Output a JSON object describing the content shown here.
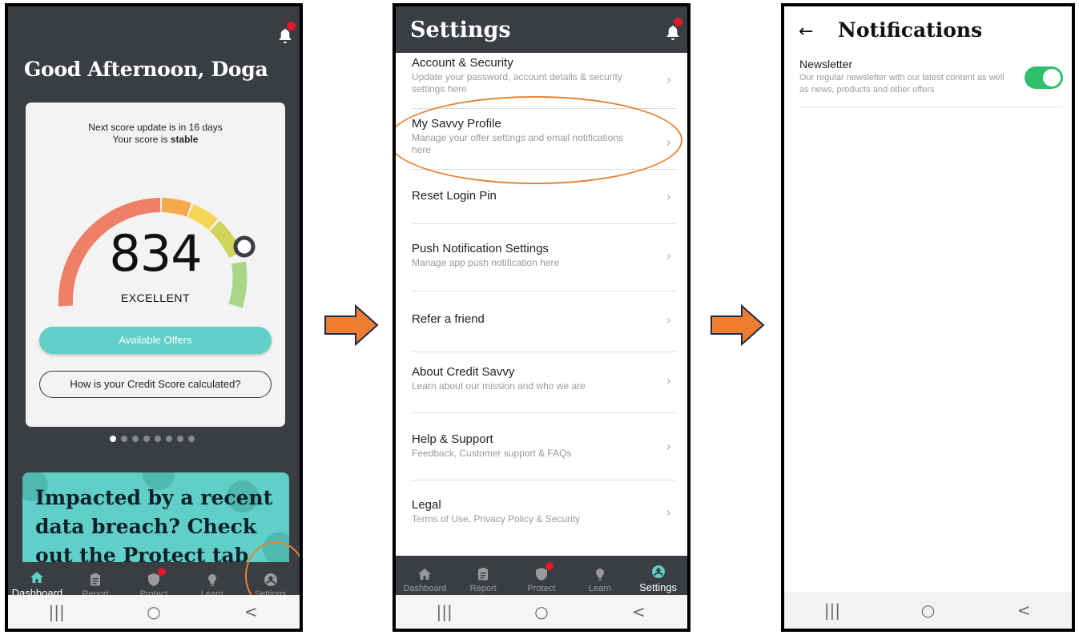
{
  "colors": {
    "accent": "#5fcfc7",
    "dark_bg": "#3a3d42",
    "highlight": "#e58336",
    "notification_dot": "#e0192e",
    "toggle_on": "#2fc06b",
    "flow_arrow": "#ee7d31"
  },
  "dashboard": {
    "greeting": "Good Afternoon, Doga",
    "next_update": "Next score update is in 16 days",
    "score_status_prefix": "Your score is ",
    "score_status": "stable",
    "score": "834",
    "rating": "EXCELLENT",
    "offers_button": "Available Offers",
    "calc_button": "How is your Credit Score calculated?",
    "carousel_pages": 8,
    "carousel_active": 1,
    "promo_text": "Impacted by a recent data breach? Check out the Protect tab"
  },
  "nav": {
    "items": [
      {
        "label": "Dashboard",
        "icon": "home-icon"
      },
      {
        "label": "Report",
        "icon": "clipboard-icon"
      },
      {
        "label": "Protect",
        "icon": "shield-icon"
      },
      {
        "label": "Learn",
        "icon": "lightbulb-icon"
      },
      {
        "label": "Settings",
        "icon": "user-circle-icon"
      }
    ]
  },
  "settings": {
    "title": "Settings",
    "items": [
      {
        "title": "Account & Security",
        "desc": "Update your password, account details & security settings here"
      },
      {
        "title": "My Savvy Profile",
        "desc": "Manage your offer settings and email notifications here"
      },
      {
        "title": "Reset Login Pin",
        "desc": ""
      },
      {
        "title": "Push Notification Settings",
        "desc": "Manage app push notification here"
      },
      {
        "title": "Refer a friend",
        "desc": ""
      },
      {
        "title": "About Credit Savvy",
        "desc": "Learn about our mission and who we are"
      },
      {
        "title": "Help & Support",
        "desc": "Feedback, Customer support & FAQs"
      },
      {
        "title": "Legal",
        "desc": "Terms of Use, Privacy Policy & Security"
      }
    ]
  },
  "notifications": {
    "back_icon": "back-arrow-icon",
    "title": "Notifications",
    "newsletter_title": "Newsletter",
    "newsletter_desc": "Our regular newsletter with our latest content as well as news, products and other offers",
    "newsletter_enabled": true
  },
  "system_nav": {
    "recents": "|||",
    "home": "○",
    "back": "<"
  }
}
